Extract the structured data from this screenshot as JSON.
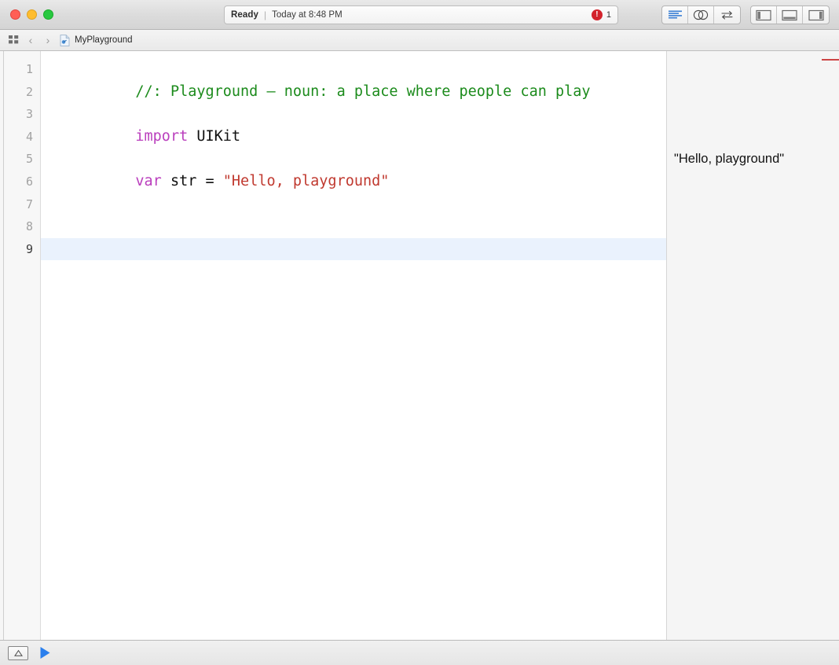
{
  "window": {
    "traffic_lights": [
      {
        "name": "close",
        "color": "#ff5f56"
      },
      {
        "name": "minimize",
        "color": "#ffbd2e"
      },
      {
        "name": "zoom",
        "color": "#28c840"
      }
    ]
  },
  "status": {
    "state": "Ready",
    "separator": "|",
    "timestamp": "Today at 8:48 PM",
    "error_icon": "!",
    "error_count": "1",
    "error_color": "#d3232c"
  },
  "toolbar": {
    "editor_modes": [
      {
        "name": "standard-editor",
        "icon": "lines-icon",
        "active": true
      },
      {
        "name": "assistant-editor",
        "icon": "venn-circles-icon",
        "active": false
      },
      {
        "name": "version-editor",
        "icon": "two-way-arrow-icon",
        "active": false
      }
    ],
    "panel_toggles": [
      {
        "name": "toggle-navigator",
        "icon": "left-panel-icon"
      },
      {
        "name": "toggle-debug-area",
        "icon": "bottom-panel-icon"
      },
      {
        "name": "toggle-utilities",
        "icon": "right-panel-icon"
      }
    ]
  },
  "jumpbar": {
    "grid_icon": "grid-icon",
    "back_chevron": "‹",
    "forward_chevron": "›",
    "file_icon": "playground-file-icon",
    "file_name": "MyPlayground"
  },
  "editor": {
    "line_numbers": [
      "1",
      "2",
      "3",
      "4",
      "5",
      "6",
      "7",
      "8",
      "9"
    ],
    "current_line": 9,
    "lines": [
      {
        "num": "1",
        "tokens": [
          {
            "text": "//: Playground — noun: a place where people can play",
            "type": "comment"
          }
        ]
      },
      {
        "num": "2",
        "tokens": []
      },
      {
        "num": "3",
        "tokens": [
          {
            "text": "import",
            "type": "keyword"
          },
          {
            "text": " UIKit",
            "type": "plain"
          }
        ]
      },
      {
        "num": "4",
        "tokens": []
      },
      {
        "num": "5",
        "tokens": [
          {
            "text": "var",
            "type": "keyword"
          },
          {
            "text": " str = ",
            "type": "plain"
          },
          {
            "text": "\"Hello, playground\"",
            "type": "string"
          }
        ]
      },
      {
        "num": "6",
        "tokens": []
      },
      {
        "num": "7",
        "tokens": []
      },
      {
        "num": "8",
        "tokens": []
      },
      {
        "num": "9",
        "tokens": []
      }
    ],
    "syntax_colors": {
      "comment": "#1c8b1c",
      "keyword": "#ba3fbd",
      "string": "#c0392f",
      "plain": "#101010",
      "current_line_background": "#eaf2fd"
    }
  },
  "results": {
    "values": [
      "",
      "",
      "",
      "",
      "\"Hello, playground\"",
      "",
      "",
      "",
      ""
    ],
    "error_marker_color": "#cc4444"
  },
  "bottombar": {
    "console_toggle": "console-toggle-icon",
    "run_button": "run-playground-icon",
    "run_color": "#2a7fed"
  }
}
